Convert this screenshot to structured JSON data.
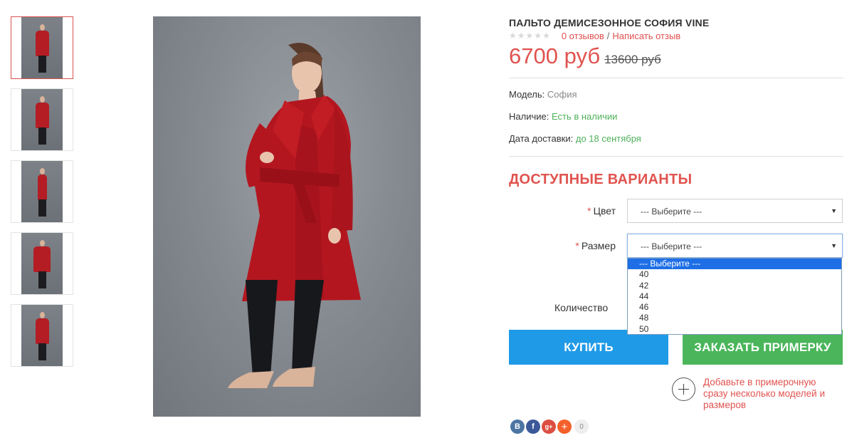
{
  "thumbnails": [
    {
      "alt": "Пальто София фото 1",
      "active": true
    },
    {
      "alt": "Пальто София фото 2",
      "active": false
    },
    {
      "alt": "Пальто София фото 3",
      "active": false
    },
    {
      "alt": "Пальто София фото 4",
      "active": false
    },
    {
      "alt": "Пальто София фото 5",
      "active": false
    }
  ],
  "product": {
    "title": "Пальто демисезонное София VINE",
    "reviews_link": "0 отзывов",
    "separator": "/",
    "write_review_link": "Написать отзыв",
    "rating": 0,
    "price_new": "6700 руб",
    "price_old": "13600 руб",
    "model_label": "Модель:",
    "model_value": "София",
    "stock_label": "Наличие:",
    "stock_value": "Есть в наличии",
    "delivery_label": "Дата доставки:",
    "delivery_value": "до 18 сентября"
  },
  "variants": {
    "title": "Доступные варианты",
    "color_label": "Цвет",
    "color_value": "--- Выберите ---",
    "size_label": "Размер",
    "size_value": "--- Выберите ---",
    "size_options": [
      "--- Выберите ---",
      "40",
      "42",
      "44",
      "46",
      "48",
      "50"
    ],
    "quantity_label": "Количество"
  },
  "actions": {
    "buy_label": "КУПИТЬ",
    "fitting_label": "ЗАКАЗАТЬ ПРИМЕРКУ",
    "add_to_fitting_text": "Добавьте в примерочную сразу несколько моделей и размеров"
  },
  "social": {
    "vk": "В",
    "fb": "f",
    "gplus": "g+",
    "more": "+",
    "count": "0"
  },
  "colors": {
    "accent_red": "#e0534f",
    "buy_blue": "#1f9ae7",
    "fit_green": "#4ab55a",
    "stock_green": "#4fb15a"
  }
}
